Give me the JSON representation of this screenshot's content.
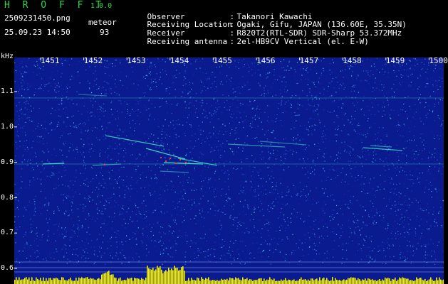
{
  "header": {
    "app_title": "H R O F F T",
    "app_version": "1.0.0",
    "file_name": "2509231450.png",
    "mode": "meteor",
    "datetime": "25.09.23 14:50",
    "count": "93"
  },
  "station": {
    "rows": [
      {
        "label": "Observer",
        "value": "Takanori Kawachi"
      },
      {
        "label": "Receiving Location",
        "value": "Ogaki, Gifu, JAPAN (136.60E, 35.35N)"
      },
      {
        "label": "Receiver",
        "value": "R820T2(RTL-SDR) SDR-Sharp 53.372MHz"
      },
      {
        "label": "Receiving antenna",
        "value": "2el-HB9CV Vertical (el. E-W)"
      }
    ],
    "separator": ":"
  },
  "axes": {
    "unit": "kHz",
    "time_ticks": [
      "1451",
      "1452",
      "1453",
      "1454",
      "1455",
      "1456",
      "1457",
      "1458",
      "1459",
      "1500"
    ],
    "freq_ticks": [
      "1.1",
      "1.0",
      "0.9",
      "0.8",
      "0.7",
      "0.6"
    ]
  },
  "colors": {
    "background": "#0a1a8f",
    "text_green": "#2bd94a",
    "signal": "#3fe6c8",
    "peak": "#ff3b3b",
    "histogram": "#f2ee00"
  }
}
